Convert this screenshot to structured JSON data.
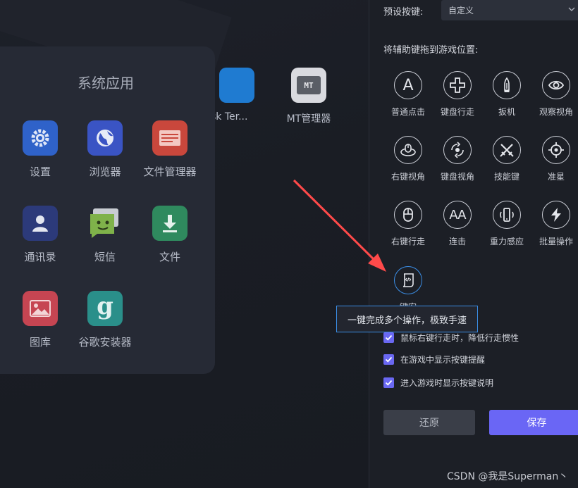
{
  "desktop": {
    "apps": [
      {
        "label": "sk Ter...",
        "icon": "terminal-app-icon"
      },
      {
        "label": "MT管理器",
        "icon": "mt-manager-icon",
        "glyph": "MT"
      }
    ]
  },
  "system_apps": {
    "title": "系统应用",
    "items": [
      {
        "label": "设置",
        "icon": "settings-gear-icon",
        "color": "#2f62c9"
      },
      {
        "label": "浏览器",
        "icon": "globe-icon",
        "color": "#3a54c4"
      },
      {
        "label": "文件管理器",
        "icon": "folder-icon",
        "color": "#c9473c"
      },
      {
        "label": "通讯录",
        "icon": "contact-icon",
        "color": "#2c3a7a"
      },
      {
        "label": "短信",
        "icon": "message-icon",
        "color": "#7fb24a"
      },
      {
        "label": "文件",
        "icon": "download-icon",
        "color": "#2f8a5e"
      },
      {
        "label": "图库",
        "icon": "gallery-icon",
        "color": "#c64552"
      },
      {
        "label": "谷歌安装器",
        "icon": "google-installer-icon",
        "color": "#2a8f8a",
        "glyph": "g"
      }
    ]
  },
  "settings": {
    "preset_label": "预设按键:",
    "preset_value": "自定义",
    "drag_hint": "将辅助键拖到游戏位置:",
    "keys": [
      {
        "label": "普通点击",
        "icon": "letter-a-icon",
        "glyph": "A"
      },
      {
        "label": "键盘行走",
        "icon": "dpad-icon"
      },
      {
        "label": "扳机",
        "icon": "bullet-icon"
      },
      {
        "label": "观察视角",
        "icon": "eye-icon"
      },
      {
        "label": "右键视角",
        "icon": "mouse-orbit-icon"
      },
      {
        "label": "键盘视角",
        "icon": "rotate-view-icon"
      },
      {
        "label": "技能键",
        "icon": "crossed-swords-icon"
      },
      {
        "label": "准星",
        "icon": "crosshair-icon"
      },
      {
        "label": "右键行走",
        "icon": "mouse-icon"
      },
      {
        "label": "连击",
        "icon": "double-a-icon",
        "glyph": "AA"
      },
      {
        "label": "重力感应",
        "icon": "phone-gravity-icon"
      },
      {
        "label": "批量操作",
        "icon": "lightning-icon"
      },
      {
        "label": "键宏",
        "icon": "macro-script-icon"
      }
    ],
    "checkboxes": [
      {
        "label": "鼠标右键行走时，降低行走惯性",
        "checked": true
      },
      {
        "label": "在游戏中显示按键提醒",
        "checked": true
      },
      {
        "label": "进入游戏时显示按键说明",
        "checked": true
      }
    ],
    "reset_label": "还原",
    "save_label": "保存"
  },
  "tooltip": "一键完成多个操作，极致手速",
  "watermark": "CSDN @我是Superman丶",
  "colors": {
    "accent": "#6a66f5",
    "tooltip_border": "#3b8ee6",
    "arrow": "#ff4a4a"
  }
}
